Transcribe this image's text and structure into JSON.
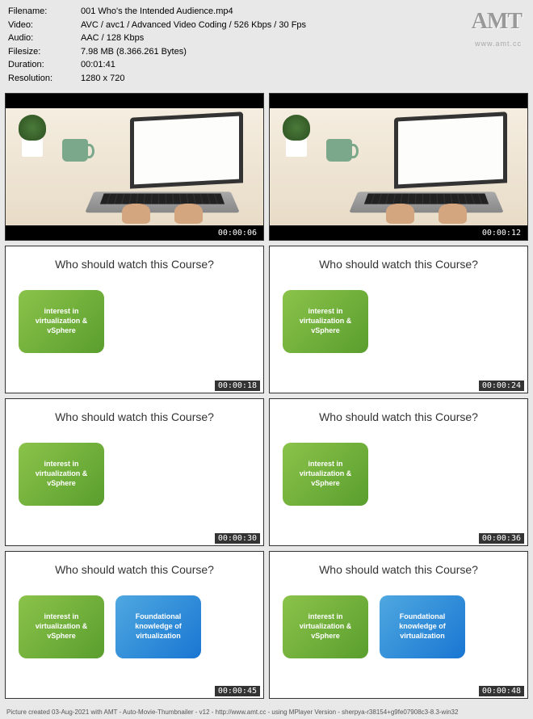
{
  "header": {
    "filename_label": "Filename:",
    "filename": "001 Who's the Intended Audience.mp4",
    "video_label": "Video:",
    "video": "AVC / avc1 / Advanced Video Coding / 526 Kbps / 30 Fps",
    "audio_label": "Audio:",
    "audio": "AAC / 128 Kbps",
    "filesize_label": "Filesize:",
    "filesize": "7.98 MB (8.366.261 Bytes)",
    "duration_label": "Duration:",
    "duration": "00:01:41",
    "resolution_label": "Resolution:",
    "resolution": "1280 x 720"
  },
  "logo": {
    "text": "AMT",
    "url": "www.amt.cc"
  },
  "slide": {
    "title": "Who should watch this Course?",
    "green_text": "interest in virtualization & vSphere",
    "blue_text": "Foundational knowledge of virtualization"
  },
  "thumbs": [
    {
      "ts": "00:00:06"
    },
    {
      "ts": "00:00:12"
    },
    {
      "ts": "00:00:18"
    },
    {
      "ts": "00:00:24"
    },
    {
      "ts": "00:00:30"
    },
    {
      "ts": "00:00:36"
    },
    {
      "ts": "00:00:45"
    },
    {
      "ts": "00:00:48"
    }
  ],
  "footer": "Picture created 03-Aug-2021 with AMT - Auto-Movie-Thumbnailer - v12 - http://www.amt.cc - using MPlayer Version - sherpya-r38154+g9fe07908c3-8.3-win32"
}
